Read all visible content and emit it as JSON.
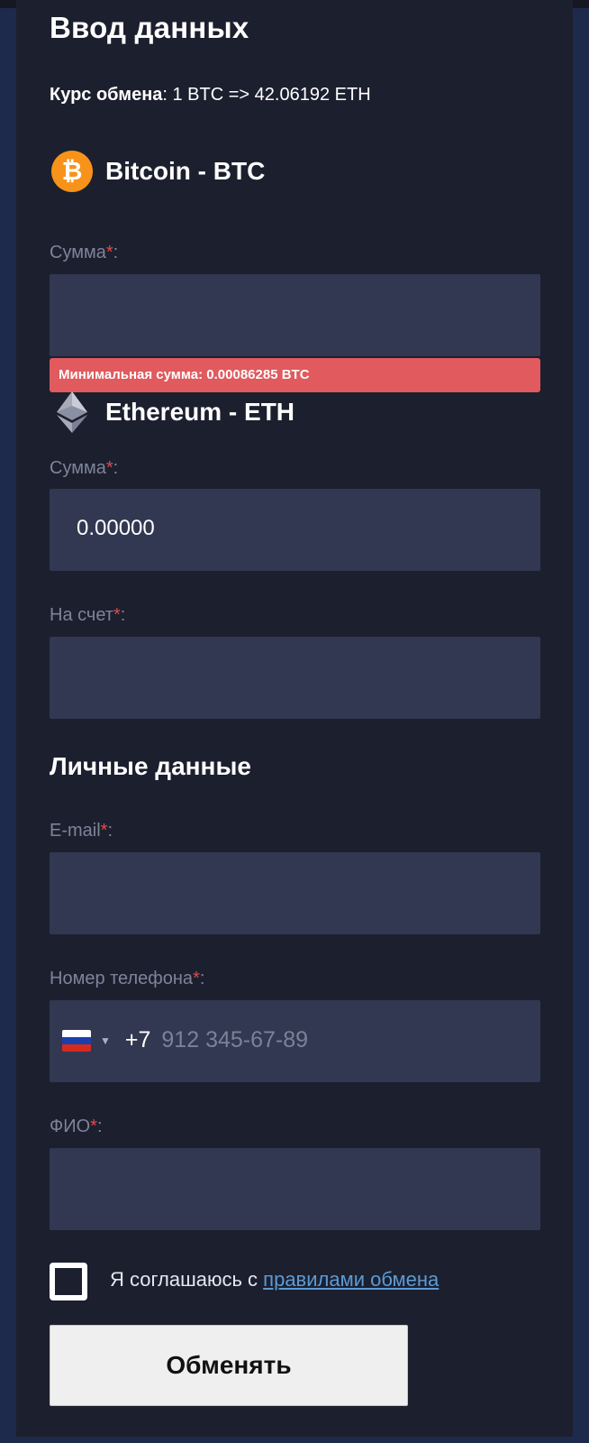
{
  "form": {
    "title": "Ввод данных",
    "rate_label": "Курс обмена",
    "rate_value": ": 1 BTC => 42.06192 ETH"
  },
  "from": {
    "icon": "bitcoin-icon",
    "icon_glyph": "₿",
    "name": "Bitcoin - BTC",
    "amount_label": "Сумма",
    "amount_value": "",
    "error": "Минимальная сумма: 0.00086285 BTC"
  },
  "to": {
    "icon": "ethereum-icon",
    "name": "Ethereum - ETH",
    "amount_label": "Сумма",
    "amount_value": "0.00000",
    "account_label": "На счет",
    "account_value": ""
  },
  "personal": {
    "title": "Личные данные",
    "email_label": "E-mail",
    "email_value": "",
    "phone_label": "Номер телефона",
    "phone_country_code": "+7",
    "phone_placeholder": "912 345-67-89",
    "fio_label": "ФИО",
    "fio_value": ""
  },
  "required_mark": "*",
  "label_suffix": ":",
  "agreement": {
    "checked": false,
    "text": "Я соглашаюсь с ",
    "link_text": "правилами обмена"
  },
  "submit_label": "Обменять",
  "colors": {
    "background": "#1e2a4c",
    "card": "#1c1f2e",
    "field": "#323851",
    "error": "#e05a5e",
    "required": "#e04b4b",
    "link": "#5b9bd5",
    "bitcoin": "#f7931a"
  }
}
